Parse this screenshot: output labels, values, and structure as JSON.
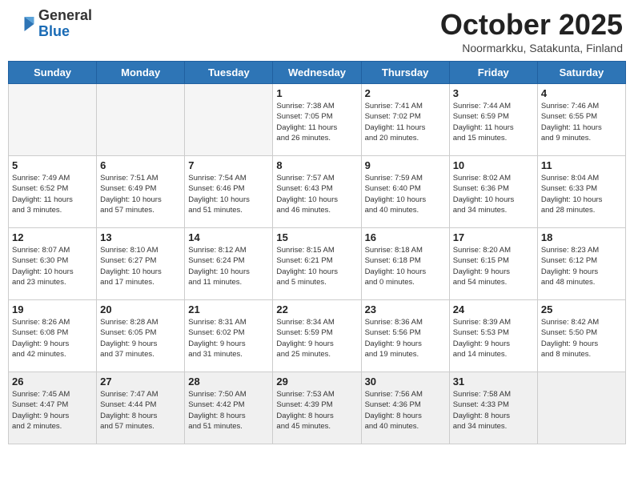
{
  "logo": {
    "general": "General",
    "blue": "Blue"
  },
  "title": "October 2025",
  "subtitle": "Noormarkku, Satakunta, Finland",
  "headers": [
    "Sunday",
    "Monday",
    "Tuesday",
    "Wednesday",
    "Thursday",
    "Friday",
    "Saturday"
  ],
  "weeks": [
    [
      {
        "day": "",
        "info": ""
      },
      {
        "day": "",
        "info": ""
      },
      {
        "day": "",
        "info": ""
      },
      {
        "day": "1",
        "info": "Sunrise: 7:38 AM\nSunset: 7:05 PM\nDaylight: 11 hours\nand 26 minutes."
      },
      {
        "day": "2",
        "info": "Sunrise: 7:41 AM\nSunset: 7:02 PM\nDaylight: 11 hours\nand 20 minutes."
      },
      {
        "day": "3",
        "info": "Sunrise: 7:44 AM\nSunset: 6:59 PM\nDaylight: 11 hours\nand 15 minutes."
      },
      {
        "day": "4",
        "info": "Sunrise: 7:46 AM\nSunset: 6:55 PM\nDaylight: 11 hours\nand 9 minutes."
      }
    ],
    [
      {
        "day": "5",
        "info": "Sunrise: 7:49 AM\nSunset: 6:52 PM\nDaylight: 11 hours\nand 3 minutes."
      },
      {
        "day": "6",
        "info": "Sunrise: 7:51 AM\nSunset: 6:49 PM\nDaylight: 10 hours\nand 57 minutes."
      },
      {
        "day": "7",
        "info": "Sunrise: 7:54 AM\nSunset: 6:46 PM\nDaylight: 10 hours\nand 51 minutes."
      },
      {
        "day": "8",
        "info": "Sunrise: 7:57 AM\nSunset: 6:43 PM\nDaylight: 10 hours\nand 46 minutes."
      },
      {
        "day": "9",
        "info": "Sunrise: 7:59 AM\nSunset: 6:40 PM\nDaylight: 10 hours\nand 40 minutes."
      },
      {
        "day": "10",
        "info": "Sunrise: 8:02 AM\nSunset: 6:36 PM\nDaylight: 10 hours\nand 34 minutes."
      },
      {
        "day": "11",
        "info": "Sunrise: 8:04 AM\nSunset: 6:33 PM\nDaylight: 10 hours\nand 28 minutes."
      }
    ],
    [
      {
        "day": "12",
        "info": "Sunrise: 8:07 AM\nSunset: 6:30 PM\nDaylight: 10 hours\nand 23 minutes."
      },
      {
        "day": "13",
        "info": "Sunrise: 8:10 AM\nSunset: 6:27 PM\nDaylight: 10 hours\nand 17 minutes."
      },
      {
        "day": "14",
        "info": "Sunrise: 8:12 AM\nSunset: 6:24 PM\nDaylight: 10 hours\nand 11 minutes."
      },
      {
        "day": "15",
        "info": "Sunrise: 8:15 AM\nSunset: 6:21 PM\nDaylight: 10 hours\nand 5 minutes."
      },
      {
        "day": "16",
        "info": "Sunrise: 8:18 AM\nSunset: 6:18 PM\nDaylight: 10 hours\nand 0 minutes."
      },
      {
        "day": "17",
        "info": "Sunrise: 8:20 AM\nSunset: 6:15 PM\nDaylight: 9 hours\nand 54 minutes."
      },
      {
        "day": "18",
        "info": "Sunrise: 8:23 AM\nSunset: 6:12 PM\nDaylight: 9 hours\nand 48 minutes."
      }
    ],
    [
      {
        "day": "19",
        "info": "Sunrise: 8:26 AM\nSunset: 6:08 PM\nDaylight: 9 hours\nand 42 minutes."
      },
      {
        "day": "20",
        "info": "Sunrise: 8:28 AM\nSunset: 6:05 PM\nDaylight: 9 hours\nand 37 minutes."
      },
      {
        "day": "21",
        "info": "Sunrise: 8:31 AM\nSunset: 6:02 PM\nDaylight: 9 hours\nand 31 minutes."
      },
      {
        "day": "22",
        "info": "Sunrise: 8:34 AM\nSunset: 5:59 PM\nDaylight: 9 hours\nand 25 minutes."
      },
      {
        "day": "23",
        "info": "Sunrise: 8:36 AM\nSunset: 5:56 PM\nDaylight: 9 hours\nand 19 minutes."
      },
      {
        "day": "24",
        "info": "Sunrise: 8:39 AM\nSunset: 5:53 PM\nDaylight: 9 hours\nand 14 minutes."
      },
      {
        "day": "25",
        "info": "Sunrise: 8:42 AM\nSunset: 5:50 PM\nDaylight: 9 hours\nand 8 minutes."
      }
    ],
    [
      {
        "day": "26",
        "info": "Sunrise: 7:45 AM\nSunset: 4:47 PM\nDaylight: 9 hours\nand 2 minutes."
      },
      {
        "day": "27",
        "info": "Sunrise: 7:47 AM\nSunset: 4:44 PM\nDaylight: 8 hours\nand 57 minutes."
      },
      {
        "day": "28",
        "info": "Sunrise: 7:50 AM\nSunset: 4:42 PM\nDaylight: 8 hours\nand 51 minutes."
      },
      {
        "day": "29",
        "info": "Sunrise: 7:53 AM\nSunset: 4:39 PM\nDaylight: 8 hours\nand 45 minutes."
      },
      {
        "day": "30",
        "info": "Sunrise: 7:56 AM\nSunset: 4:36 PM\nDaylight: 8 hours\nand 40 minutes."
      },
      {
        "day": "31",
        "info": "Sunrise: 7:58 AM\nSunset: 4:33 PM\nDaylight: 8 hours\nand 34 minutes."
      },
      {
        "day": "",
        "info": ""
      }
    ]
  ]
}
